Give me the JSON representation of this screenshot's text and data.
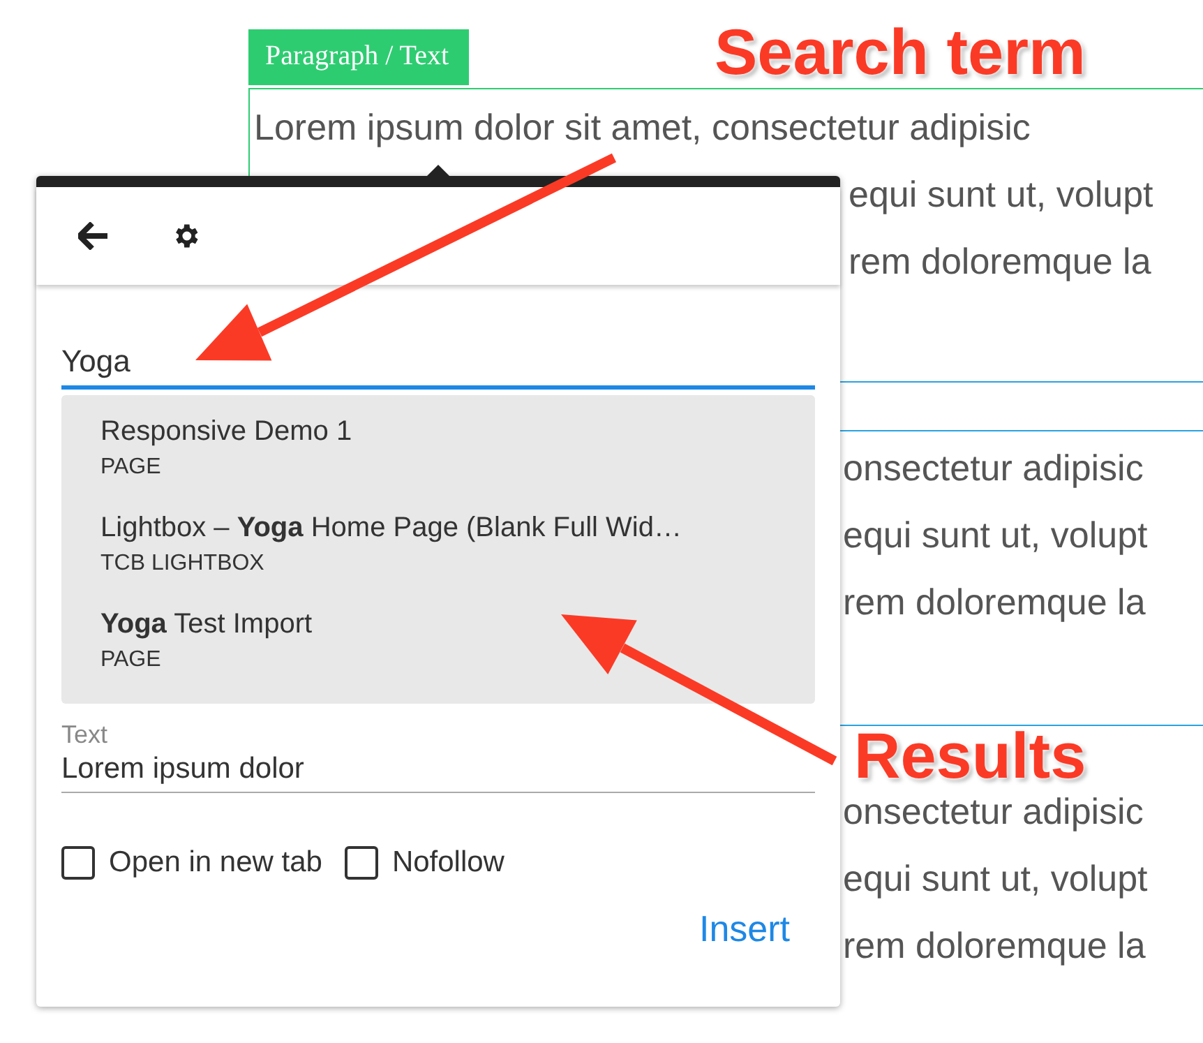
{
  "element_label": "Paragraph / Text",
  "editor": {
    "paragraphs": [
      {
        "selected": true,
        "lines": [
          "Lorem ipsum dolor sit amet, consectetur adipisic",
          "equi sunt ut, volupt",
          "rem doloremque la"
        ]
      },
      {
        "selected": false,
        "lines": [
          "onsectetur adipisic",
          "equi sunt ut, volupt",
          "rem doloremque la"
        ]
      },
      {
        "selected": false,
        "lines": [
          "onsectetur adipisic",
          "equi sunt ut, volupt",
          "rem doloremque la"
        ]
      }
    ]
  },
  "link_popup": {
    "search": {
      "value": "Yoga"
    },
    "results": [
      {
        "title": "Responsive Demo 1",
        "type": "PAGE"
      },
      {
        "title": "Lightbox – **Yoga** Home Page (Blank Full Wid…",
        "type": "TCB LIGHTBOX"
      },
      {
        "title": "**Yoga** Test Import",
        "type": "PAGE"
      }
    ],
    "text_field": {
      "label": "Text",
      "value": "Lorem ipsum dolor"
    },
    "options": [
      {
        "label": "Open in new tab",
        "checked": false
      },
      {
        "label": "Nofollow",
        "checked": false
      }
    ],
    "insert_button": "Insert"
  },
  "annotations": [
    {
      "label": "Search term"
    },
    {
      "label": "Results"
    }
  ]
}
